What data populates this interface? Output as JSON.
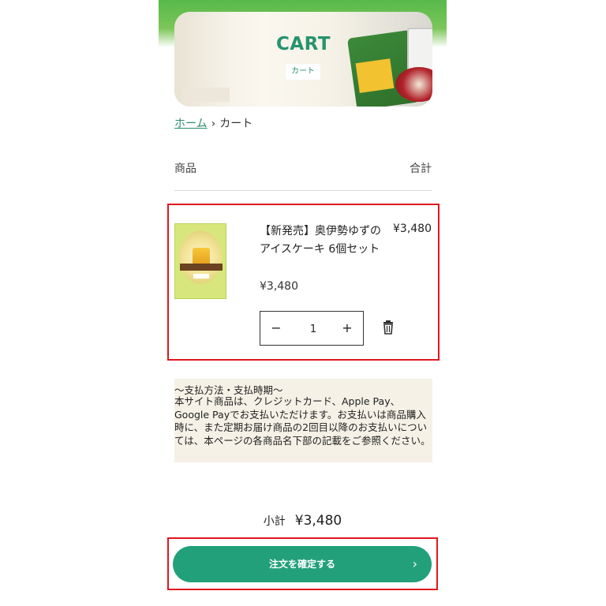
{
  "header": {
    "title": "CART",
    "subtitle": "カート"
  },
  "breadcrumb": {
    "home": "ホーム",
    "separator": "›",
    "current": "カート"
  },
  "table": {
    "col_product": "商品",
    "col_total": "合計"
  },
  "item": {
    "title": "【新発売】奥伊勢ゆずのアイスケーキ 6個セット",
    "line_total": "¥3,480",
    "unit_price": "¥3,480",
    "quantity": "1",
    "minus_label": "−",
    "plus_label": "+"
  },
  "notice": {
    "heading": "〜支払方法・支払時期〜",
    "body": "本サイト商品は、クレジットカード、Apple Pay、Google Payでお支払いただけます。お支払いは商品購入時に、また定期お届け商品の2回目以降のお支払いについては、本ページの各商品名下部の記載をご参照ください。"
  },
  "summary": {
    "subtotal_label": "小計",
    "subtotal_value": "¥3,480"
  },
  "checkout": {
    "label": "注文を確定する",
    "chevron": "›"
  },
  "colors": {
    "accent": "#22a07a",
    "link": "#2a8e6c",
    "highlight": "#e0171f"
  }
}
